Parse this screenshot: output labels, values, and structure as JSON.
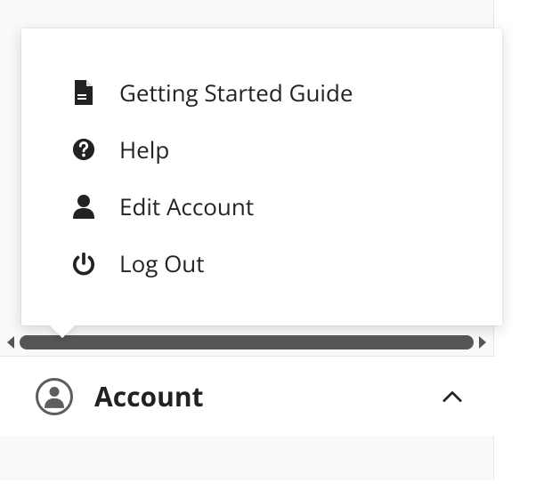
{
  "menu": {
    "items": [
      {
        "icon": "document-icon",
        "label": "Getting Started Guide"
      },
      {
        "icon": "help-icon",
        "label": "Help"
      },
      {
        "icon": "user-icon",
        "label": "Edit Account"
      },
      {
        "icon": "power-icon",
        "label": "Log Out"
      }
    ]
  },
  "account": {
    "label": "Account"
  }
}
